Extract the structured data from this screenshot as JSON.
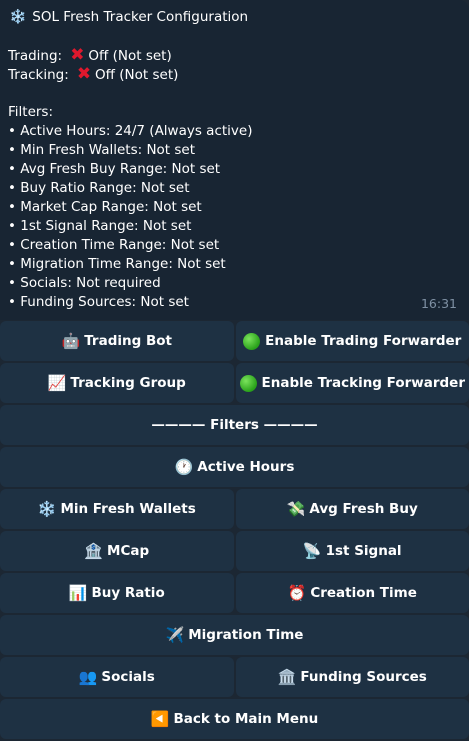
{
  "message": {
    "title_icon": "❄️",
    "title": "SOL Fresh Tracker Configuration",
    "trading_label": "Trading:",
    "trading_value": "Off (Not set)",
    "tracking_label": "Tracking:",
    "tracking_value": "Off (Not set)",
    "filters_heading": "Filters:",
    "filters": [
      "• Active Hours: 24/7 (Always active)",
      "• Min Fresh Wallets: Not set",
      "• Avg Fresh Buy Range: Not set",
      "• Buy Ratio Range: Not set",
      "• Market Cap Range: Not set",
      "• 1st Signal Range: Not set",
      "• Creation Time Range: Not set",
      "• Migration Time Range: Not set",
      "• Socials: Not required",
      "• Funding Sources: Not set"
    ],
    "time": "16:31"
  },
  "icons": {
    "off": "cross-mark",
    "robot": "🤖",
    "chart": "📈",
    "clock": "🕐",
    "snowflake": "❄️",
    "money": "💸",
    "bank": "🏦",
    "satellite": "📡",
    "bar_chart": "📊",
    "alarm": "⏰",
    "airplane": "✈️",
    "people": "👥",
    "institution": "🏛️",
    "back": "◀️"
  },
  "buttons": {
    "trading_bot": "Trading Bot",
    "enable_trading_forwarder": "Enable Trading Forwarder",
    "tracking_group": "Tracking Group",
    "enable_tracking_forwarder": "Enable Tracking Forwarder",
    "filters_divider": "———— Filters ————",
    "active_hours": "Active Hours",
    "min_fresh_wallets": "Min Fresh Wallets",
    "avg_fresh_buy": "Avg Fresh Buy",
    "mcap": "MCap",
    "first_signal": "1st Signal",
    "buy_ratio": "Buy Ratio",
    "creation_time": "Creation Time",
    "migration_time": "Migration Time",
    "socials": "Socials",
    "funding_sources": "Funding Sources",
    "back_to_main_menu": "Back to Main Menu"
  },
  "colors": {
    "background": "#1c2733",
    "message_bg": "#182533",
    "button_bg": "#1e3143",
    "cross": "#e0182d",
    "time": "#7f91a4"
  }
}
